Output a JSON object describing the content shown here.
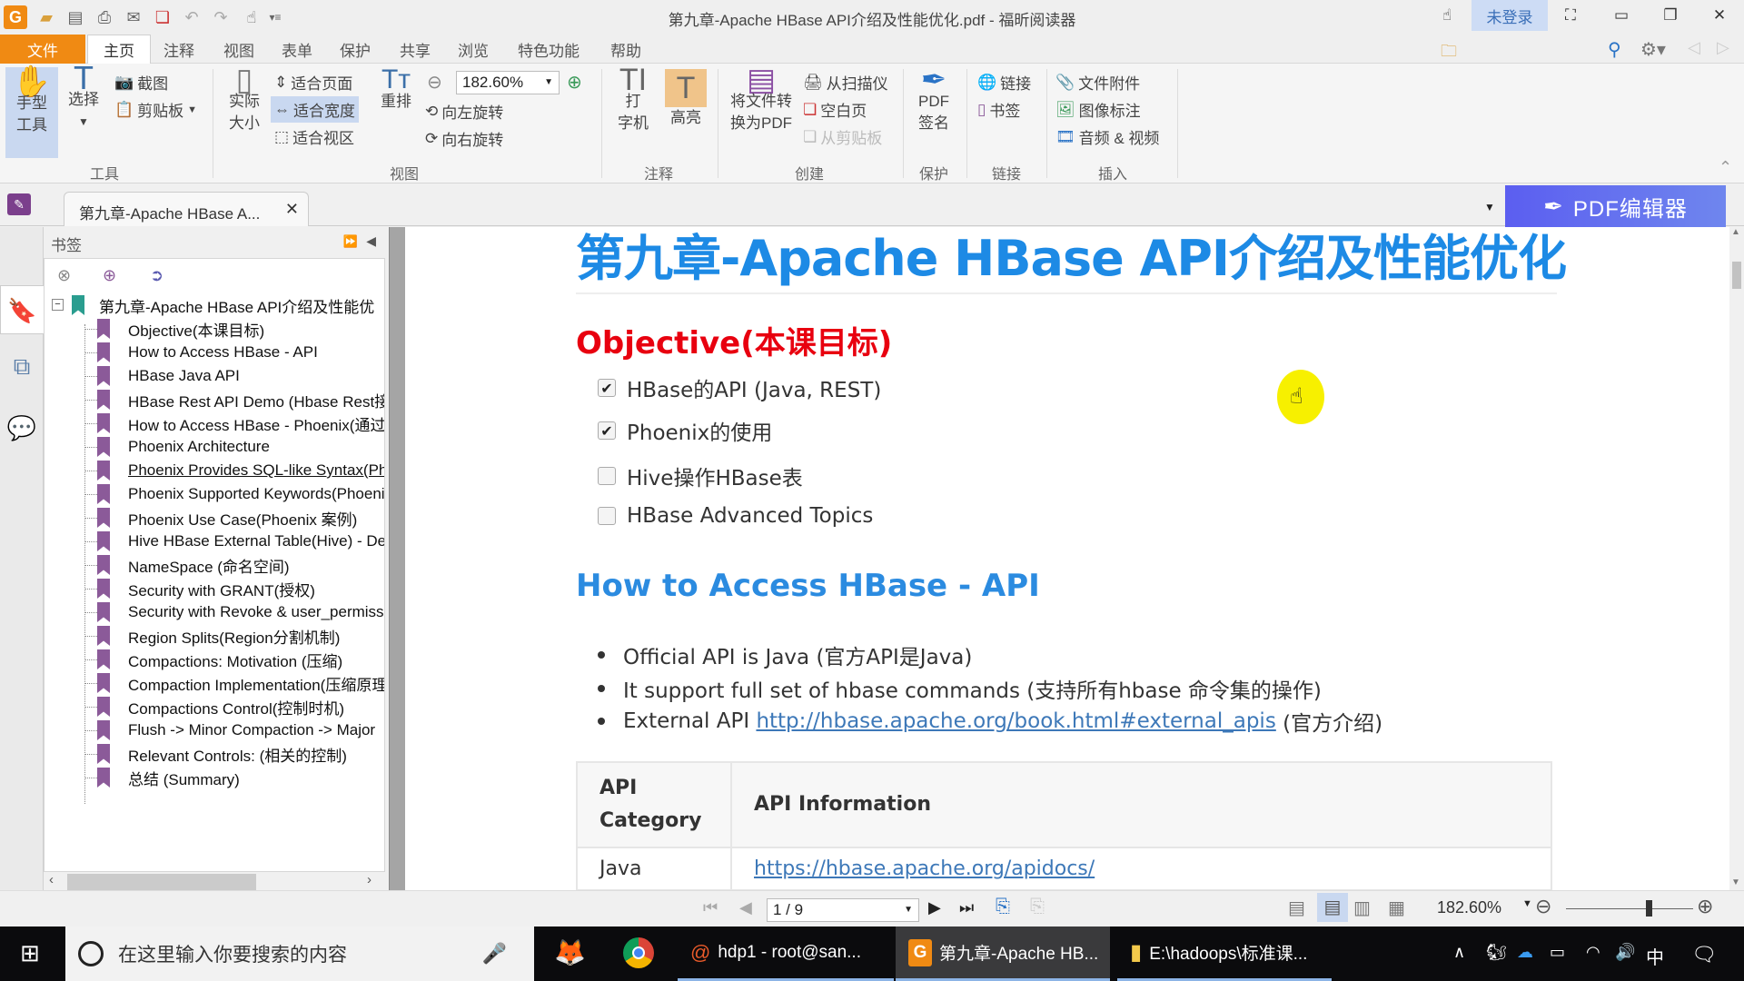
{
  "window": {
    "title": "第九章-Apache HBase API介绍及性能优化.pdf - 福昕阅读器",
    "login_label": "未登录",
    "colors": {
      "accent_orange": "#f08a13",
      "heading_blue": "#1d8ae5",
      "heading_red": "#e8000f",
      "pdf_editor_bg": "#5b5ef0"
    }
  },
  "menu": {
    "items": [
      "文件",
      "主页",
      "注释",
      "视图",
      "表单",
      "保护",
      "共享",
      "浏览",
      "特色功能",
      "帮助"
    ],
    "search_placeholder": "查找"
  },
  "ribbon": {
    "tools": {
      "hand": "手型\n工具",
      "select": "选择",
      "snapshot": "截图",
      "clipboard": "剪贴板",
      "label": "工具"
    },
    "view": {
      "actual_size": "实际\n大小",
      "fit_page": "适合页面",
      "fit_width": "适合宽度",
      "fit_visible": "适合视区",
      "reflow": "重排",
      "zoom_value": "182.60%",
      "rotate_left": "向左旋转",
      "rotate_right": "向右旋转",
      "label": "视图"
    },
    "annotate": {
      "typewriter": "打\n字机",
      "highlight": "高亮",
      "label": "注释"
    },
    "create": {
      "convert": "将文件转\n换为PDF",
      "from_scanner": "从扫描仪",
      "blank_page": "空白页",
      "from_clipboard": "从剪贴板",
      "label": "创建"
    },
    "protect": {
      "sign": "PDF\n签名",
      "label": "保护"
    },
    "links": {
      "link": "链接",
      "bookmark": "书签",
      "label": "链接"
    },
    "insert": {
      "attachment": "文件附件",
      "image_annot": "图像标注",
      "audio_video": "音频 & 视频",
      "label": "插入"
    }
  },
  "tabs": {
    "doc_tab": "第九章-Apache HBase A...",
    "pdf_editor": "PDF编辑器"
  },
  "bookmarks": {
    "title": "书签",
    "root": "第九章-Apache HBase API介绍及性能优",
    "items": [
      "Objective(本课目标)",
      "How to Access HBase - API",
      "HBase Java API",
      "HBase Rest API Demo (Hbase Rest接",
      "How to Access HBase - Phoenix(通过",
      "Phoenix Architecture",
      "Phoenix Provides SQL-like Syntax(Ph",
      "Phoenix Supported Keywords(Phoeni",
      "Phoenix Use Case(Phoenix 案例)",
      "Hive HBase External Table(Hive) - De",
      "NameSpace (命名空间)",
      "Security with GRANT(授权)",
      "Security with Revoke & user_permiss",
      "Region Splits(Region分割机制)",
      "Compactions: Motivation (压缩)",
      "Compaction Implementation(压缩原理",
      "Compactions Control(控制时机)",
      "Flush -> Minor Compaction -> Major",
      "Relevant Controls: (相关的控制)",
      "总结 (Summary)"
    ]
  },
  "document": {
    "title": "第九章-Apache HBase API介绍及性能优化",
    "objective_heading": "Objective(本课目标)",
    "tasks": [
      {
        "label": "HBase的API (Java, REST)",
        "checked": true
      },
      {
        "label": "Phoenix的使用",
        "checked": true
      },
      {
        "label": "Hive操作HBase表",
        "checked": false
      },
      {
        "label": "HBase Advanced Topics",
        "checked": false
      }
    ],
    "section_heading": "How to Access HBase - API",
    "bullets": {
      "b1": "Official API is Java (官方API是Java)",
      "b2": "It support full set of hbase commands (支持所有hbase 命令集的操作)",
      "b3_prefix": "External API ",
      "b3_link": "http://hbase.apache.org/book.html#external_apis",
      "b3_suffix": " (官方介绍)"
    },
    "table": {
      "headers": [
        "API Category",
        "API Information"
      ],
      "rows": [
        [
          "Java",
          "https://hbase.apache.org/apidocs/"
        ]
      ]
    }
  },
  "statusbar": {
    "page": "1 / 9",
    "zoom": "182.60%",
    "zoom_slider_fraction": 0.65
  },
  "taskbar": {
    "search_placeholder": "在这里输入你要搜索的内容",
    "apps": [
      {
        "label": "hdp1 - root@san..."
      },
      {
        "label": "第九章-Apache HB..."
      },
      {
        "label": "E:\\hadoops\\标准课..."
      }
    ],
    "ime": "中"
  }
}
